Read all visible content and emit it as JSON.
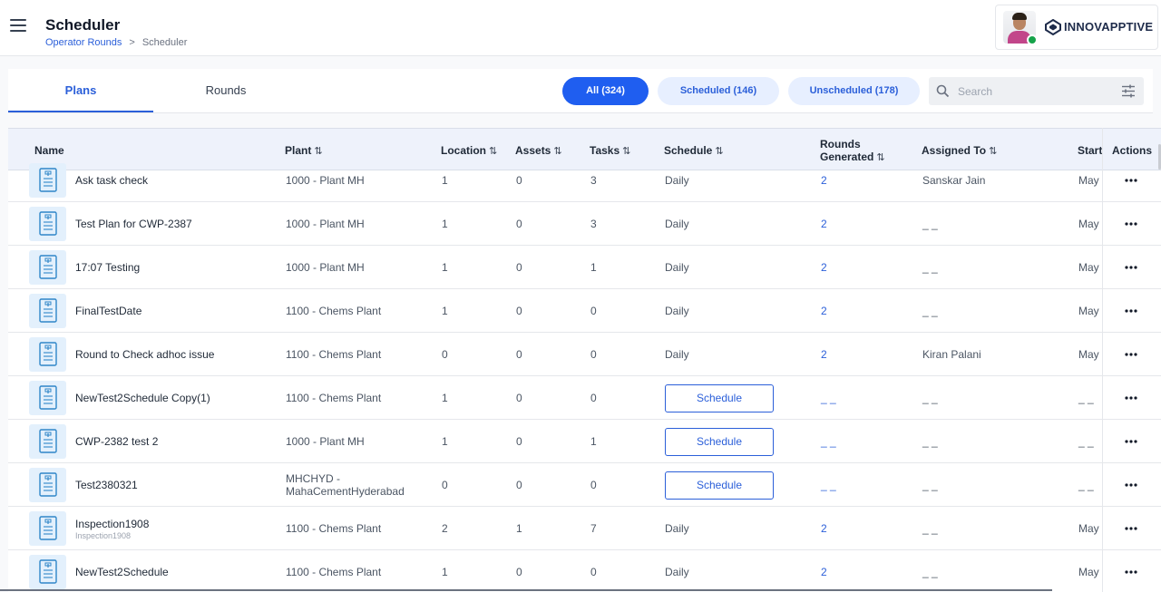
{
  "header": {
    "title": "Scheduler",
    "breadcrumb": {
      "parent": "Operator Rounds",
      "separator": ">",
      "current": "Scheduler"
    },
    "brand": "INNOVAPPTIVE",
    "user_status": "online"
  },
  "tabs": [
    {
      "label": "Plans",
      "active": true
    },
    {
      "label": "Rounds",
      "active": false
    }
  ],
  "filters": [
    {
      "label": "All (324)",
      "selected": true
    },
    {
      "label": "Scheduled (146)",
      "selected": false
    },
    {
      "label": "Unscheduled (178)",
      "selected": false
    }
  ],
  "search": {
    "placeholder": "Search",
    "value": ""
  },
  "table": {
    "columns": {
      "name": "Name",
      "plant": "Plant",
      "location": "Location",
      "assets": "Assets",
      "tasks": "Tasks",
      "schedule": "Schedule",
      "rounds_generated_1": "Rounds",
      "rounds_generated_2": "Generated",
      "assigned_to": "Assigned To",
      "start": "Start",
      "actions": "Actions"
    },
    "sort_glyph": "⇅",
    "schedule_button_label": "Schedule",
    "rows": [
      {
        "name": "Ask task check",
        "sub": "",
        "plant": "1000 - Plant MH",
        "plant_2": "",
        "location": "1",
        "assets": "0",
        "tasks": "3",
        "schedule": "Daily",
        "rounds": "2",
        "assigned": "Sanskar Jain",
        "start": "May"
      },
      {
        "name": "Test Plan for CWP-2387",
        "sub": "",
        "plant": "1000 - Plant MH",
        "plant_2": "",
        "location": "1",
        "assets": "0",
        "tasks": "3",
        "schedule": "Daily",
        "rounds": "2",
        "assigned": "_ _",
        "start": "May"
      },
      {
        "name": "17:07 Testing",
        "sub": "",
        "plant": "1000 - Plant MH",
        "plant_2": "",
        "location": "1",
        "assets": "0",
        "tasks": "1",
        "schedule": "Daily",
        "rounds": "2",
        "assigned": "_ _",
        "start": "May"
      },
      {
        "name": "FinalTestDate",
        "sub": "",
        "plant": "1100 - Chems Plant",
        "plant_2": "",
        "location": "1",
        "assets": "0",
        "tasks": "0",
        "schedule": "Daily",
        "rounds": "2",
        "assigned": "_ _",
        "start": "May"
      },
      {
        "name": "Round to Check adhoc issue",
        "sub": "",
        "plant": "1100 - Chems Plant",
        "plant_2": "",
        "location": "0",
        "assets": "0",
        "tasks": "0",
        "schedule": "Daily",
        "rounds": "2",
        "assigned": "Kiran Palani",
        "start": "May"
      },
      {
        "name": "NewTest2Schedule Copy(1)",
        "sub": "",
        "plant": "1100 - Chems Plant",
        "plant_2": "",
        "location": "1",
        "assets": "0",
        "tasks": "0",
        "schedule": "",
        "rounds": "_ _",
        "assigned": "_ _",
        "start": "_ _"
      },
      {
        "name": "CWP-2382 test 2",
        "sub": "",
        "plant": "1000 - Plant MH",
        "plant_2": "",
        "location": "1",
        "assets": "0",
        "tasks": "1",
        "schedule": "",
        "rounds": "_ _",
        "assigned": "_ _",
        "start": "_ _"
      },
      {
        "name": "Test2380321",
        "sub": "",
        "plant": "MHCHYD -",
        "plant_2": "MahaCementHyderabad",
        "location": "0",
        "assets": "0",
        "tasks": "0",
        "schedule": "",
        "rounds": "_ _",
        "assigned": "_ _",
        "start": "_ _"
      },
      {
        "name": "Inspection1908",
        "sub": "Inspection1908",
        "plant": "1100 - Chems Plant",
        "plant_2": "",
        "location": "2",
        "assets": "1",
        "tasks": "7",
        "schedule": "Daily",
        "rounds": "2",
        "assigned": "_ _",
        "start": "May"
      },
      {
        "name": "NewTest2Schedule",
        "sub": "",
        "plant": "1100 - Chems Plant",
        "plant_2": "",
        "location": "1",
        "assets": "0",
        "tasks": "0",
        "schedule": "Daily",
        "rounds": "2",
        "assigned": "_ _",
        "start": "May"
      }
    ]
  },
  "colors": {
    "accent": "#1f5ef0",
    "link": "#2b5fd9",
    "pill_bg": "#e7efff",
    "header_bg": "#eef2fb",
    "status_online": "#16a34a"
  }
}
